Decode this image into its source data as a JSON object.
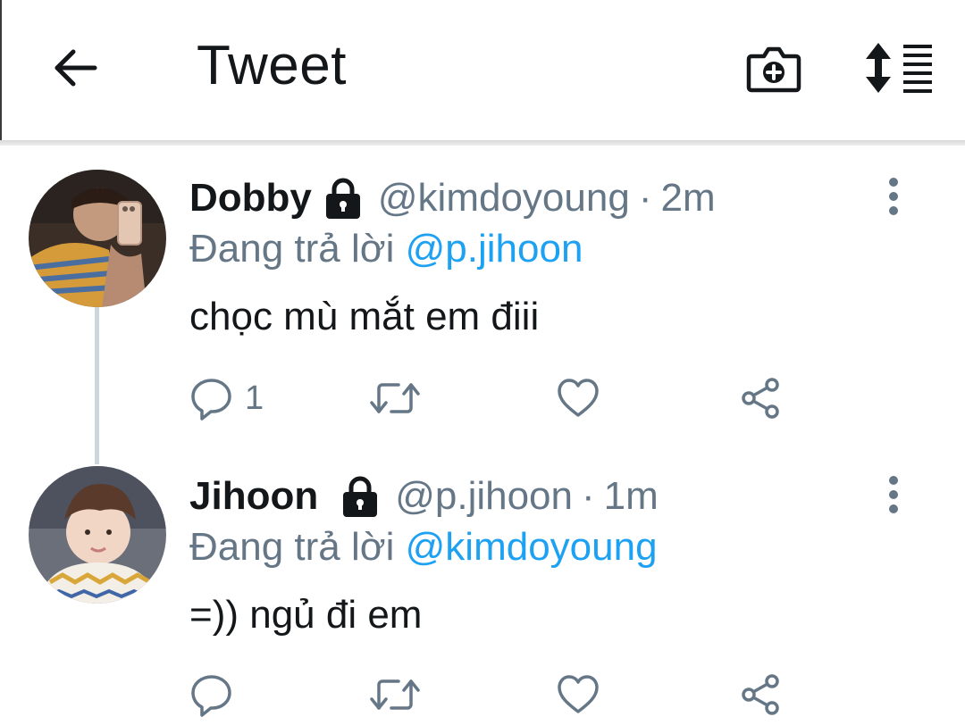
{
  "header": {
    "title": "Tweet",
    "back_icon": "arrow-left-icon",
    "camera_icon": "camera-add-icon",
    "sort_icon": "sort-list-icon"
  },
  "tweets": [
    {
      "display_name": "Dobby",
      "handle": "@kimdoyoung",
      "separator": "·",
      "time": "2m",
      "replying_prefix": "Đang trả lời",
      "replying_to": "@p.jihoon",
      "text": "chọc mù mắt em điii",
      "reply_count": "1",
      "protected": true
    },
    {
      "display_name": "Jihoon",
      "handle": "@p.jihoon",
      "separator": "·",
      "time": "1m",
      "replying_prefix": "Đang trả lời",
      "replying_to": "@kimdoyoung",
      "text": "=)) ngủ đi em",
      "reply_count": "",
      "protected": true
    }
  ],
  "colors": {
    "text_primary": "#14171a",
    "text_secondary": "#657786",
    "link": "#1da1f2",
    "divider": "#ccd6dd"
  }
}
